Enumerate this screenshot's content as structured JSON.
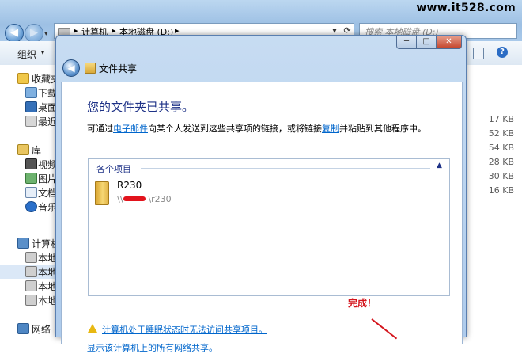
{
  "watermark": "www.it528.com",
  "explorer": {
    "breadcrumb": [
      "计算机",
      "本地磁盘 (D:)"
    ],
    "search_placeholder": "搜索 本地磁盘 (D:)",
    "toolbar": {
      "organize_label": "组织",
      "organize_arrow": "▾"
    },
    "nav": {
      "back_glyph": "◀",
      "forward_glyph": "▶",
      "dropdown_glyph": "▾",
      "crumb_separator": "▸",
      "refresh_glyph": "⟳",
      "history_glyph": "▾"
    },
    "help_glyph": "?",
    "sidebar": {
      "favorites_label": "收藏夹",
      "favorites_items": [
        "下载",
        "桌面",
        "最近"
      ],
      "libraries_label": "库",
      "libraries_items": [
        "视频",
        "图片",
        "文档",
        "音乐"
      ],
      "computer_label": "计算机",
      "computer_items": [
        "本地",
        "本地",
        "本地",
        "本地"
      ],
      "network_label": "网络"
    },
    "file_sizes": [
      "17 KB",
      "52 KB",
      "54 KB",
      "28 KB",
      "30 KB",
      "16 KB"
    ]
  },
  "dialog": {
    "title": "文件共享",
    "window_buttons": {
      "minimize": "─",
      "maximize": "□",
      "close": "✕"
    },
    "back_glyph": "◀",
    "heading": "您的文件夹已共享。",
    "instructions": {
      "pre": "可通过",
      "email_link": "电子邮件",
      "mid": "向某个人发送到这些共享项的链接，或将链接",
      "copy_link": "复制",
      "post": "并粘贴到其他程序中。"
    },
    "items_panel": {
      "header": "各个项目",
      "collapse_glyph": "▲",
      "item": {
        "name": "R230",
        "path_prefix": "\\\\",
        "path_suffix": "\\r230"
      }
    },
    "warning_link": "计算机处于睡眠状态时无法访问共享项目。",
    "all_shares_link": "显示该计算机上的所有网络共享。"
  },
  "annotation": {
    "done_label": "完成！"
  }
}
